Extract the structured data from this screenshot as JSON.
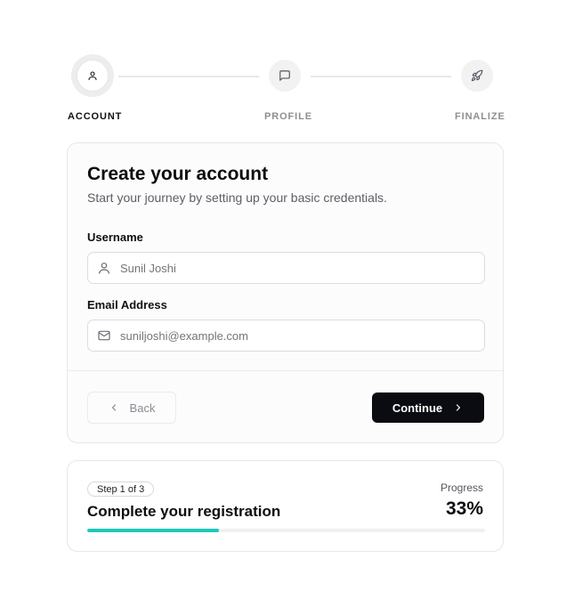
{
  "stepper": {
    "steps": [
      {
        "label": "ACCOUNT",
        "icon": "user-icon",
        "state": "active"
      },
      {
        "label": "PROFILE",
        "icon": "message-square-icon",
        "state": "inactive"
      },
      {
        "label": "FINALIZE",
        "icon": "rocket-icon",
        "state": "inactive"
      }
    ]
  },
  "form": {
    "title": "Create your account",
    "subtitle": "Start your journey by setting up your basic credentials.",
    "username": {
      "label": "Username",
      "placeholder": "Sunil Joshi",
      "icon": "user-icon"
    },
    "email": {
      "label": "Email Address",
      "placeholder": "suniljoshi@example.com",
      "icon": "mail-icon"
    },
    "back_label": "Back",
    "continue_label": "Continue"
  },
  "progress": {
    "badge": "Step 1 of 3",
    "title": "Complete your registration",
    "label": "Progress",
    "value_text": "33%",
    "fraction": 0.33,
    "accent_color": "#1ec8b8"
  }
}
